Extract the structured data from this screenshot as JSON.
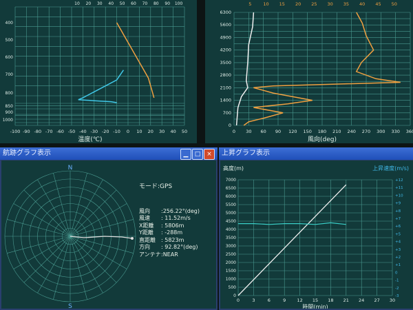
{
  "panels": {
    "temp": {
      "xticks": [
        "-100",
        "-90",
        "-80",
        "-70",
        "-60",
        "-50",
        "-40",
        "-30",
        "-20",
        "-10",
        "0",
        "10",
        "20",
        "30",
        "40",
        "50"
      ],
      "top_ticks": [
        "10",
        "20",
        "30",
        "40",
        "50",
        "60",
        "70",
        "80",
        "90",
        "100"
      ],
      "y_ticks": [
        "1000",
        "900",
        "850",
        "800",
        "700",
        "600",
        "500",
        "400"
      ],
      "xlabel": "温度(℃)"
    },
    "wind": {
      "yticks": [
        "0",
        "700",
        "1400",
        "2100",
        "2800",
        "3500",
        "4200",
        "4900",
        "5600",
        "6300"
      ],
      "xticks": [
        "0",
        "30",
        "60",
        "90",
        "120",
        "150",
        "180",
        "210",
        "240",
        "270",
        "300",
        "330",
        "360"
      ],
      "top_ticks": [
        "5",
        "10",
        "15",
        "20",
        "25",
        "30",
        "35",
        "40",
        "45",
        "50"
      ],
      "xlabel": "風向(deg)"
    },
    "track": {
      "title": "航跡グラフ表示",
      "compass": {
        "north": "N",
        "south": "S"
      },
      "info": {
        "mode": "モード:GPS",
        "rows": [
          {
            "label": "風向",
            "value": ":256.22°(deg)"
          },
          {
            "label": "風速",
            "value": ": 11.52m/s"
          },
          {
            "label": "X距離",
            "value": ": 5806m"
          },
          {
            "label": "Y距離",
            "value": ": -288m"
          },
          {
            "label": "直距離",
            "value": ": 5823m"
          },
          {
            "label": "方向",
            "value": ": 92.82°(deg)"
          },
          {
            "label": "アンテナ",
            "value": ":NEAR"
          }
        ]
      }
    },
    "ascent": {
      "title": "上昇グラフ表示",
      "ylabel": "高度(m)",
      "ylabel_right": "上昇速度(m/s)",
      "xlabel": "時間(min)",
      "yticks": [
        "0",
        "500",
        "1000",
        "1500",
        "2000",
        "2500",
        "3000",
        "3500",
        "4000",
        "4500",
        "5000",
        "5500",
        "6000",
        "6500",
        "7000"
      ],
      "xticks": [
        "0",
        "3",
        "6",
        "9",
        "12",
        "15",
        "18",
        "21",
        "24",
        "27",
        "30"
      ],
      "rticks": [
        "-3",
        "-2",
        "-1",
        "0",
        "+1",
        "+2",
        "+3",
        "+4",
        "+5",
        "+6",
        "+7",
        "+8",
        "+9",
        "+10",
        "+11",
        "+12"
      ]
    }
  },
  "chart_data": [
    {
      "type": "line",
      "title": "",
      "xlabel": "温度(℃)",
      "xlim": [
        -100,
        50
      ],
      "ylim": [
        400,
        1000
      ],
      "series": [
        {
          "color": "#f0a040",
          "points": [
            [
              -10,
              480
            ],
            [
              -6,
              520
            ],
            [
              -2,
              560
            ],
            [
              2,
              600
            ],
            [
              6,
              640
            ],
            [
              10,
              680
            ],
            [
              14,
              720
            ],
            [
              18,
              760
            ],
            [
              20,
              800
            ],
            [
              22,
              840
            ],
            [
              23,
              860
            ]
          ]
        },
        {
          "color": "#40c8e8",
          "points": [
            [
              -4,
              720
            ],
            [
              -10,
              770
            ],
            [
              -20,
              800
            ],
            [
              -30,
              830
            ],
            [
              -40,
              860
            ],
            [
              -44,
              870
            ],
            [
              -30,
              875
            ],
            [
              -15,
              880
            ],
            [
              -10,
              885
            ]
          ]
        }
      ]
    },
    {
      "type": "line",
      "title": "",
      "xlabel": "風向(deg)",
      "xlim": [
        0,
        360
      ],
      "ylim": [
        0,
        6300
      ],
      "series": [
        {
          "color": "#f0a040",
          "points": [
            [
              250,
              6300
            ],
            [
              262,
              5700
            ],
            [
              270,
              5000
            ],
            [
              285,
              4200
            ],
            [
              260,
              3500
            ],
            [
              250,
              3000
            ],
            [
              290,
              2600
            ],
            [
              340,
              2400
            ],
            [
              80,
              2200
            ],
            [
              40,
              2100
            ],
            [
              80,
              1800
            ],
            [
              160,
              1400
            ],
            [
              110,
              1200
            ],
            [
              40,
              1000
            ],
            [
              100,
              700
            ],
            [
              60,
              400
            ],
            [
              30,
              200
            ],
            [
              20,
              0
            ]
          ]
        },
        {
          "color": "#f0f0f0",
          "points": [
            [
              40,
              6300
            ],
            [
              38,
              5500
            ],
            [
              30,
              4500
            ],
            [
              28,
              3500
            ],
            [
              25,
              2500
            ],
            [
              28,
              2100
            ],
            [
              15,
              1600
            ],
            [
              8,
              1000
            ],
            [
              5,
              0
            ]
          ]
        }
      ]
    },
    {
      "type": "line",
      "title": "",
      "xlabel": "時間(min)",
      "ylabel": "高度(m)",
      "xlim": [
        0,
        30
      ],
      "ylim": [
        0,
        7000
      ],
      "series": [
        {
          "color": "#f0f0f0",
          "x": [
            0,
            21
          ],
          "y": [
            0,
            6700
          ]
        },
        {
          "color": "#3ad0c8",
          "x": [
            0,
            3,
            6,
            9,
            12,
            15,
            18,
            21
          ],
          "y": [
            4350,
            4350,
            4300,
            4350,
            4350,
            4300,
            4400,
            4300
          ]
        }
      ]
    }
  ]
}
